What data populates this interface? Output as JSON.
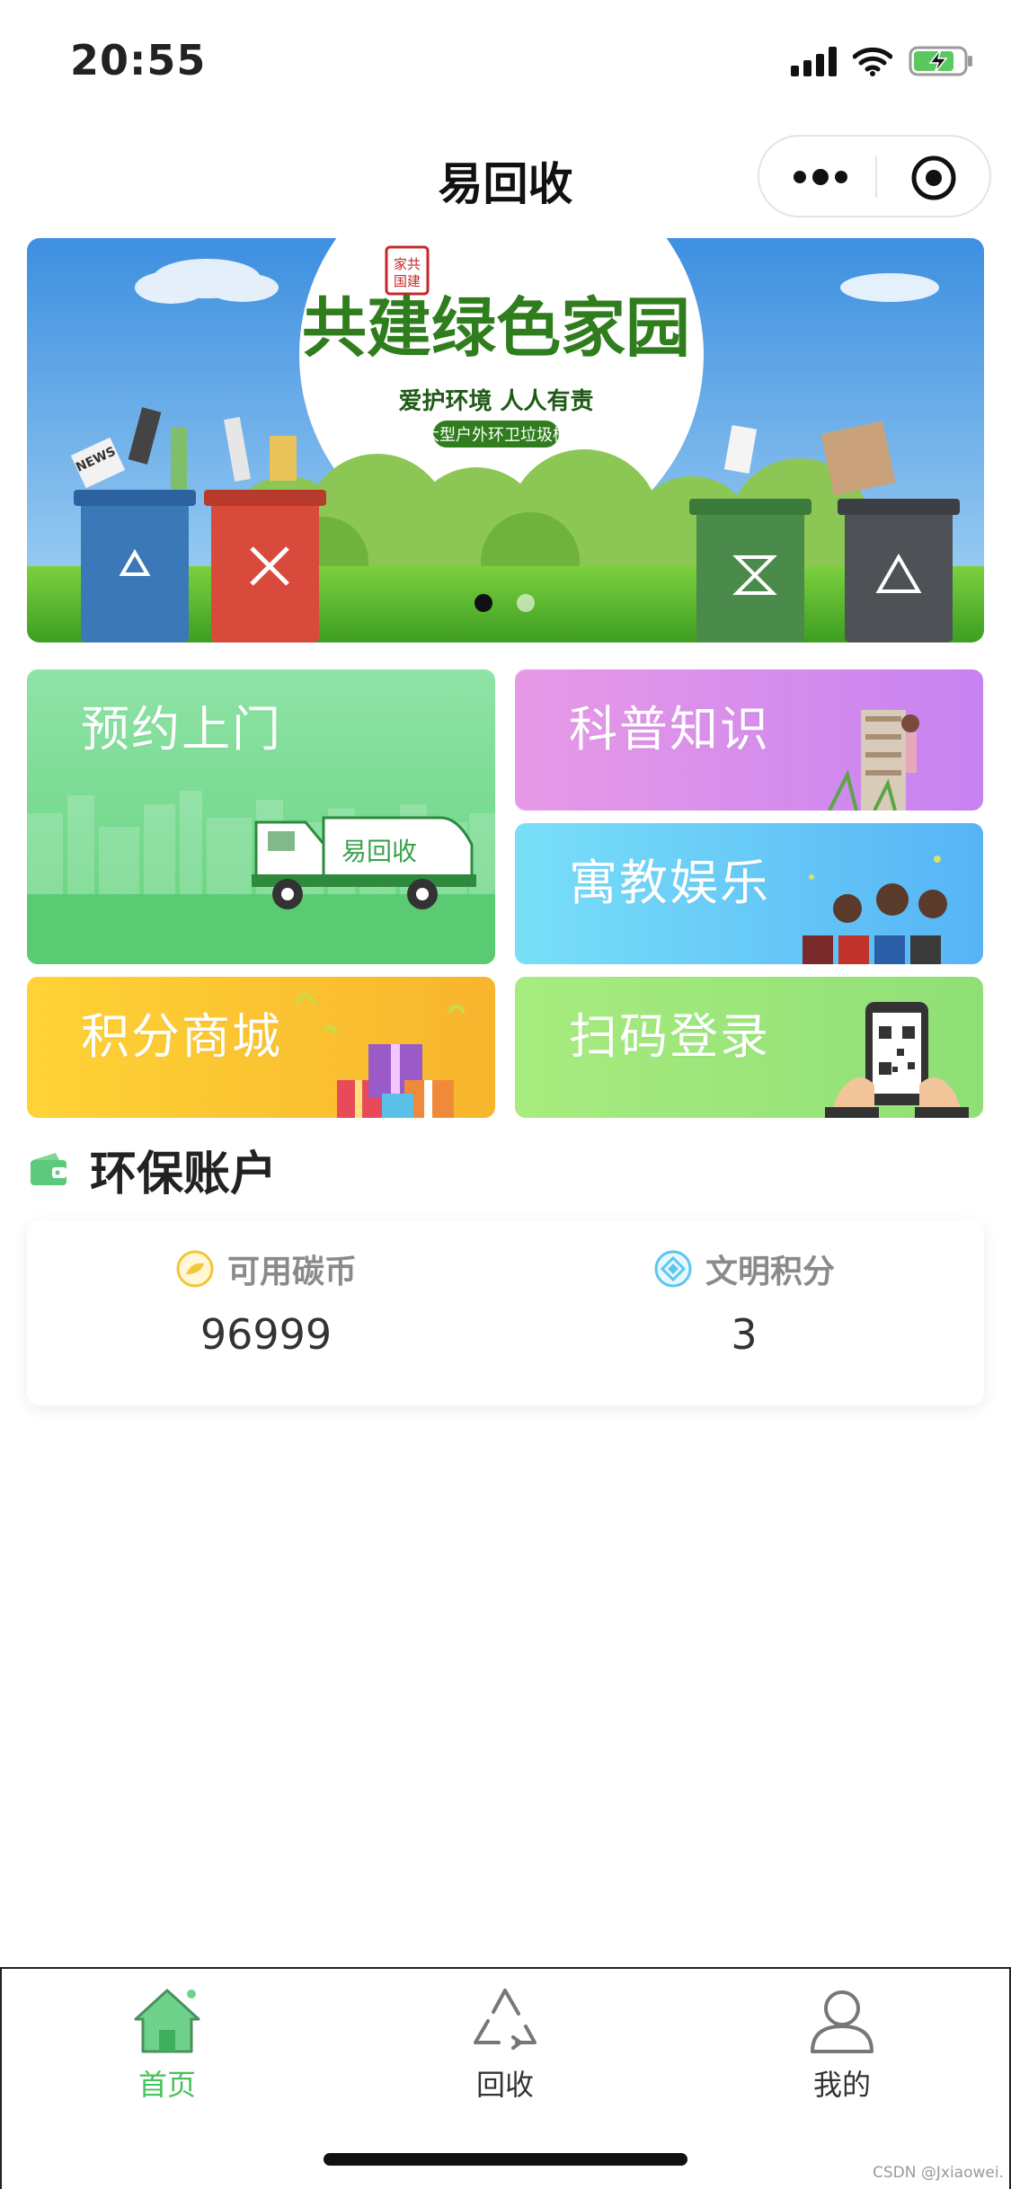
{
  "status_bar": {
    "time": "20:55"
  },
  "nav": {
    "title": "易回收"
  },
  "banner": {
    "stamp_text": "家共国建",
    "headline": "共建绿色家园",
    "slogan": "爱护环境  人人有责",
    "subtitle": "大型户外环卫垃圾桶",
    "news_label": "NEWS",
    "active_dot": 0,
    "dot_count": 2
  },
  "tiles": {
    "yuyue": "预约上门",
    "truck_text": "易回收",
    "kepu": "科普知识",
    "yujiao": "寓教娱乐",
    "jifen": "积分商城",
    "saoma": "扫码登录"
  },
  "account": {
    "section_title": "环保账户",
    "carbon_label": "可用碳币",
    "carbon_value": "96999",
    "points_label": "文明积分",
    "points_value": "3"
  },
  "tabbar": {
    "home": "首页",
    "recycle": "回收",
    "mine": "我的"
  },
  "watermark": "CSDN @Jxiaowei."
}
